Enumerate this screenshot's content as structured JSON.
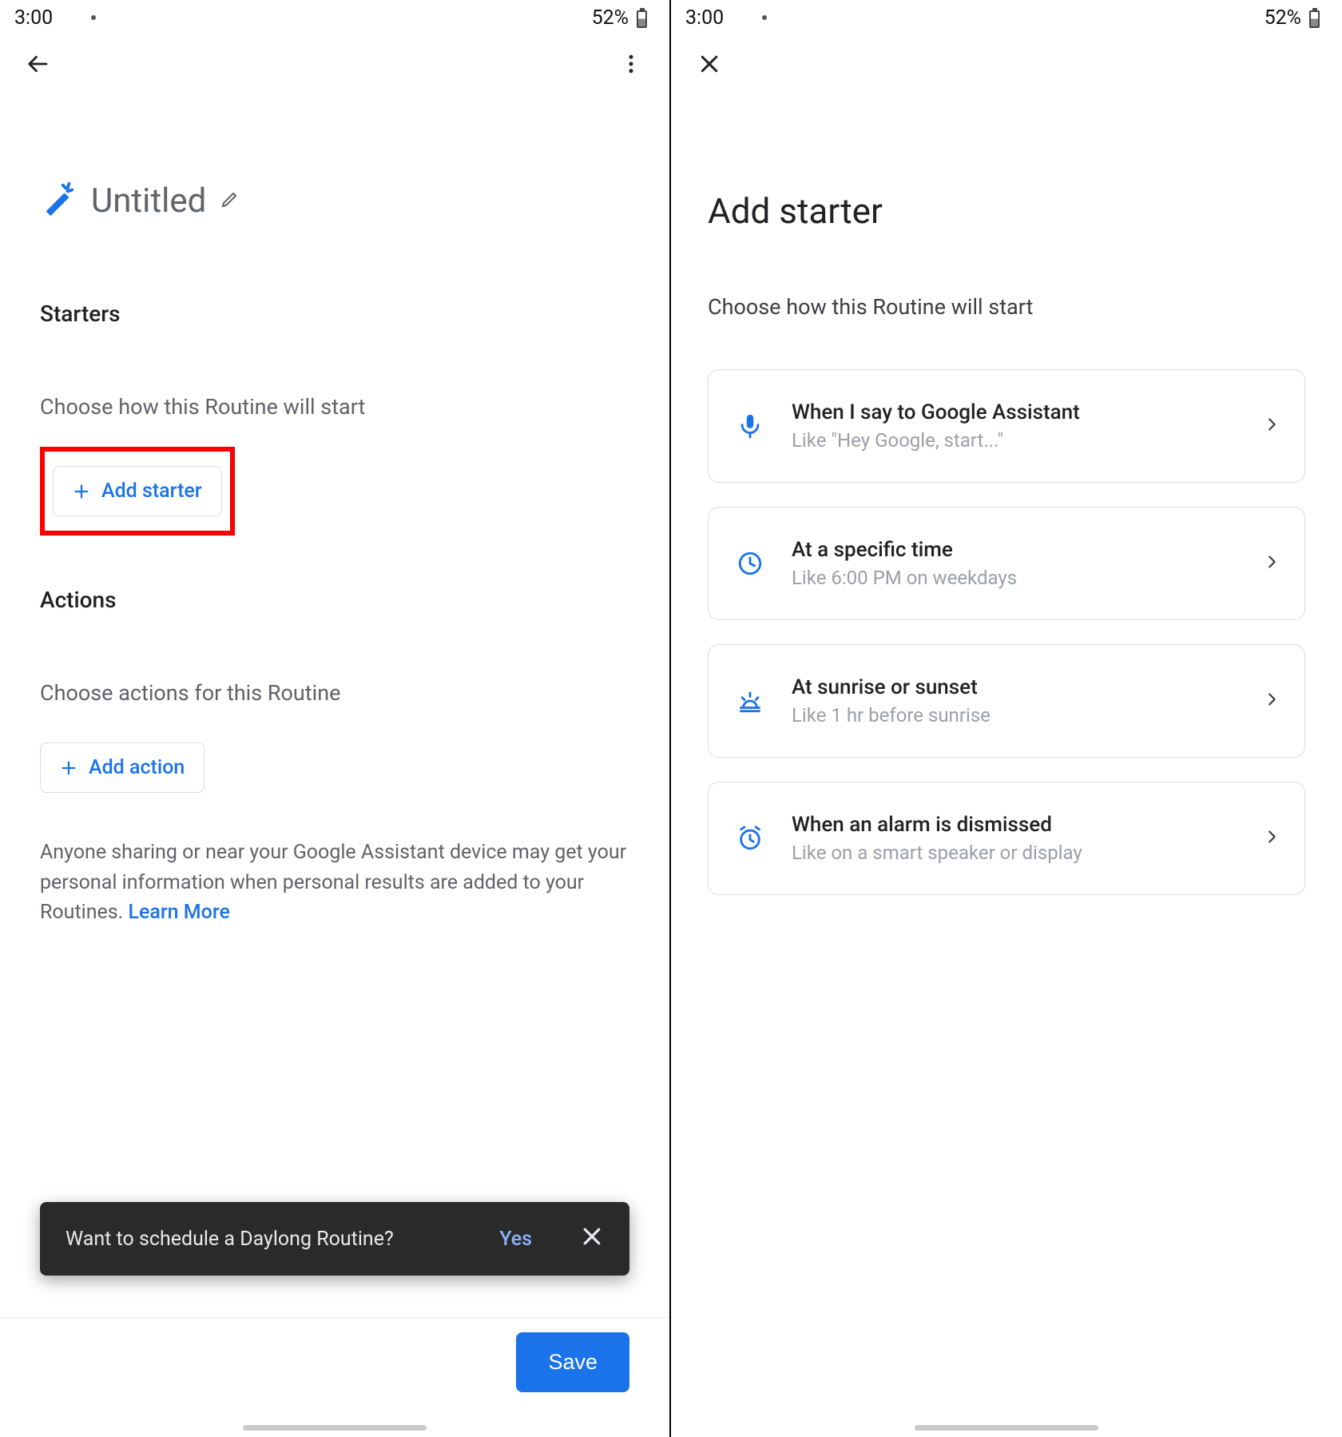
{
  "status": {
    "time": "3:00",
    "battery": "52%"
  },
  "left": {
    "title": "Untitled",
    "starters_heading": "Starters",
    "starters_sub": "Choose how this Routine will start",
    "add_starter_label": "Add starter",
    "actions_heading": "Actions",
    "actions_sub": "Choose actions for this Routine",
    "add_action_label": "Add action",
    "disclaimer_text": "Anyone sharing or near your Google Assistant device may get your personal information when personal results are added to your Routines. ",
    "learn_more": "Learn More",
    "snackbar_text": "Want to schedule a Daylong Routine?",
    "snackbar_yes": "Yes",
    "save_label": "Save"
  },
  "right": {
    "title": "Add starter",
    "subtitle": "Choose how this Routine will start",
    "options": [
      {
        "title": "When I say to Google Assistant",
        "desc": "Like \"Hey Google, start...\""
      },
      {
        "title": "At a specific time",
        "desc": "Like 6:00 PM on weekdays"
      },
      {
        "title": "At sunrise or sunset",
        "desc": "Like 1 hr before sunrise"
      },
      {
        "title": "When an alarm is dismissed",
        "desc": "Like on a smart speaker or display"
      }
    ]
  },
  "colors": {
    "accent": "#1a73e8"
  }
}
